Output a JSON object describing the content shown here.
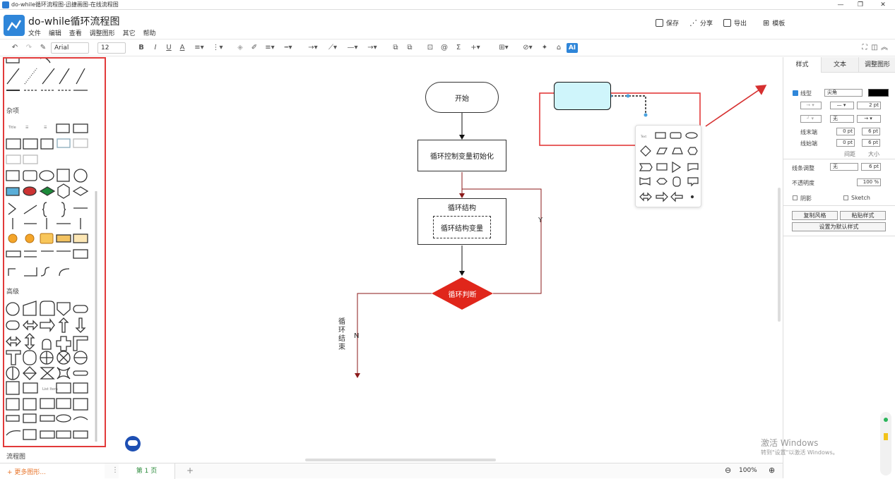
{
  "window": {
    "title": "do-while循环流程图-迅捷画图-在线流程图"
  },
  "header": {
    "doc_title": "do-while循环流程图",
    "menu": [
      "文件",
      "编辑",
      "查看",
      "调整图形",
      "其它",
      "帮助"
    ],
    "actions": {
      "save": "保存",
      "share": "分享",
      "export": "导出",
      "template": "模板"
    }
  },
  "toolbar": {
    "font": "Arial",
    "size": "12",
    "bold": "B",
    "italic": "I",
    "underline": "U",
    "fontcolor": "A",
    "ai": "AI"
  },
  "left": {
    "sections": {
      "misc": "杂项",
      "advanced": "高级",
      "flowchart": "流程图"
    },
    "more": "+ 更多图形..."
  },
  "flow": {
    "start": "开始",
    "init": "循环控制变量初始化",
    "loop_body": "循环结构",
    "loop_var": "循环结构变量",
    "cond": "循环判断",
    "yes": "Y",
    "no": "N",
    "end": "循环结束"
  },
  "right": {
    "tabs": [
      "样式",
      "文本",
      "调整图形"
    ],
    "line": "线型",
    "corner": "尖角",
    "width": "2 pt",
    "arrow_style": "无",
    "end_label": "线末端",
    "start_label": "线始端",
    "end_val1": "0 pt",
    "end_val2": "6 pt",
    "start_val1": "0 pt",
    "start_val2": "6 pt",
    "spacing": "间距",
    "size": "大小",
    "adjust": "线条调整",
    "adjust_val": "无",
    "adjust_pt": "6 pt",
    "opacity": "不透明度",
    "opacity_val": "100 %",
    "shadow": "阴影",
    "sketch": "Sketch",
    "copy_style": "复制风格",
    "paste_style": "粘贴样式",
    "default_style": "设置为默认样式"
  },
  "bottom": {
    "page": "第 1 页",
    "zoom": "100%"
  },
  "watermark": {
    "line1": "激活 Windows",
    "line2": "转到\"设置\"以激活 Windows。"
  },
  "colors": {
    "accent": "#2f86d9",
    "highlight": "#e23a3a",
    "diamond": "#e0261b",
    "selected": "#cff5fb"
  }
}
